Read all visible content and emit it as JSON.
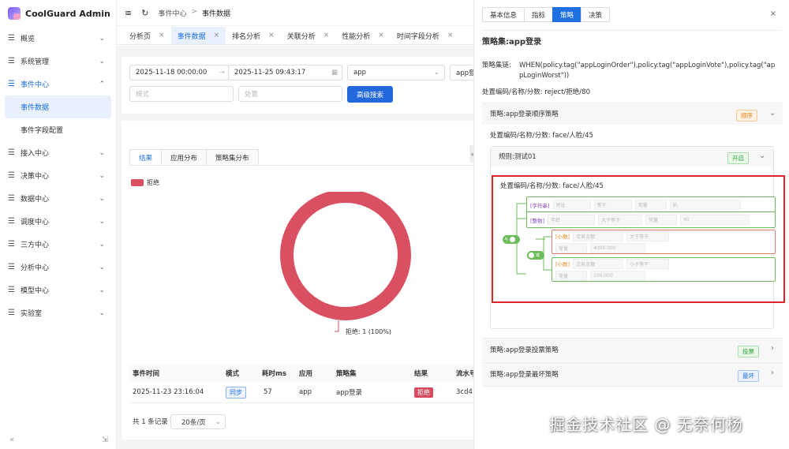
{
  "app": {
    "title": "CoolGuard Admin"
  },
  "sidebar": {
    "items": [
      {
        "label": "概览"
      },
      {
        "label": "系统管理"
      },
      {
        "label": "事件中心"
      },
      {
        "label": "接入中心"
      },
      {
        "label": "决策中心"
      },
      {
        "label": "数据中心"
      },
      {
        "label": "调度中心"
      },
      {
        "label": "三方中心"
      },
      {
        "label": "分析中心"
      },
      {
        "label": "模型中心"
      },
      {
        "label": "实验室"
      }
    ],
    "sub_items": [
      {
        "label": "事件数据"
      },
      {
        "label": "事件字段配置"
      }
    ],
    "footer_left": "«",
    "footer_right": "⇲"
  },
  "header": {
    "breadcrumb": [
      "事件中心",
      "事件数据"
    ],
    "separator": ">"
  },
  "tabs": [
    {
      "label": "分析页"
    },
    {
      "label": "事件数据"
    },
    {
      "label": "排名分析"
    },
    {
      "label": "关联分析"
    },
    {
      "label": "性能分析"
    },
    {
      "label": "时间字段分析"
    }
  ],
  "filters": {
    "start_time": "2025-11-18 00:00:00",
    "end_time": "2025-11-25 09:43:17",
    "app": "app",
    "app2": "app登",
    "mode_placeholder": "模式",
    "disposal_placeholder": "处置",
    "search_button": "高级搜索"
  },
  "result_tabs": [
    {
      "label": "结果"
    },
    {
      "label": "应用分布"
    },
    {
      "label": "策略集分布"
    }
  ],
  "chart_data": {
    "type": "pie",
    "donut": true,
    "categories": [
      "拒绝"
    ],
    "values": [
      1
    ],
    "legend": [
      "拒绝"
    ],
    "data_label": "拒绝: 1 (100%)",
    "colors": [
      "#d95063"
    ]
  },
  "table": {
    "headers": [
      "事件时间",
      "模式",
      "耗时ms",
      "应用",
      "策略集",
      "结果",
      "流水号"
    ],
    "rows": [
      [
        "2025-11-23 23:16:04",
        "同步",
        "57",
        "app",
        "app登录",
        "拒绝",
        "3cd4"
      ]
    ],
    "total_text": "共 1 条记录",
    "page_size": "20条/页"
  },
  "right_panel": {
    "tabs": [
      {
        "label": "基本信息"
      },
      {
        "label": "指标"
      },
      {
        "label": "策略"
      },
      {
        "label": "决策"
      }
    ],
    "close": "×",
    "title": "策略集:app登录",
    "chain_label": "策略集链:",
    "chain_line1": "WHEN(policy.tag(\"appLoginOrder\"),policy.tag(\"appLoginVote\"),policy.tag(\"ap",
    "chain_line2": "pLoginWorst\"))",
    "disposal": "处置编码/名称/分数: reject/拒绝/80",
    "policies": [
      {
        "name": "策略:app登录顺序策略",
        "badge": "顺序"
      },
      {
        "name": "策略:app登录投票策略",
        "badge": "投票"
      },
      {
        "name": "策略:app登录最坏策略",
        "badge": "最坏"
      }
    ],
    "policy_disposal": "处置编码/名称/分数: face/人脸/45",
    "rule": {
      "name": "规则:测试01",
      "badge": "开启"
    },
    "rule_disposal": "处置编码/名称/分数: face/人脸/45",
    "conditions": {
      "root_toggle": "与",
      "sub_toggle": "或",
      "c1": {
        "type": "[字符串]",
        "field": "地址",
        "op": "等于",
        "mode": "常量",
        "value": "杭"
      },
      "c2": {
        "type": "[整数]",
        "field": "年龄",
        "op": "大于等于",
        "mode": "常量",
        "value": "60"
      },
      "c3": {
        "type": "[小数]",
        "field": "交易金额",
        "op": "大于等于",
        "mode": "常量",
        "value": "4000.000"
      },
      "c4": {
        "type": "[小数]",
        "field": "交易金额",
        "op": "小于等于",
        "mode": "常量",
        "value": "100.000"
      }
    }
  },
  "watermark": "掘金技术社区 @ 无奈何杨"
}
